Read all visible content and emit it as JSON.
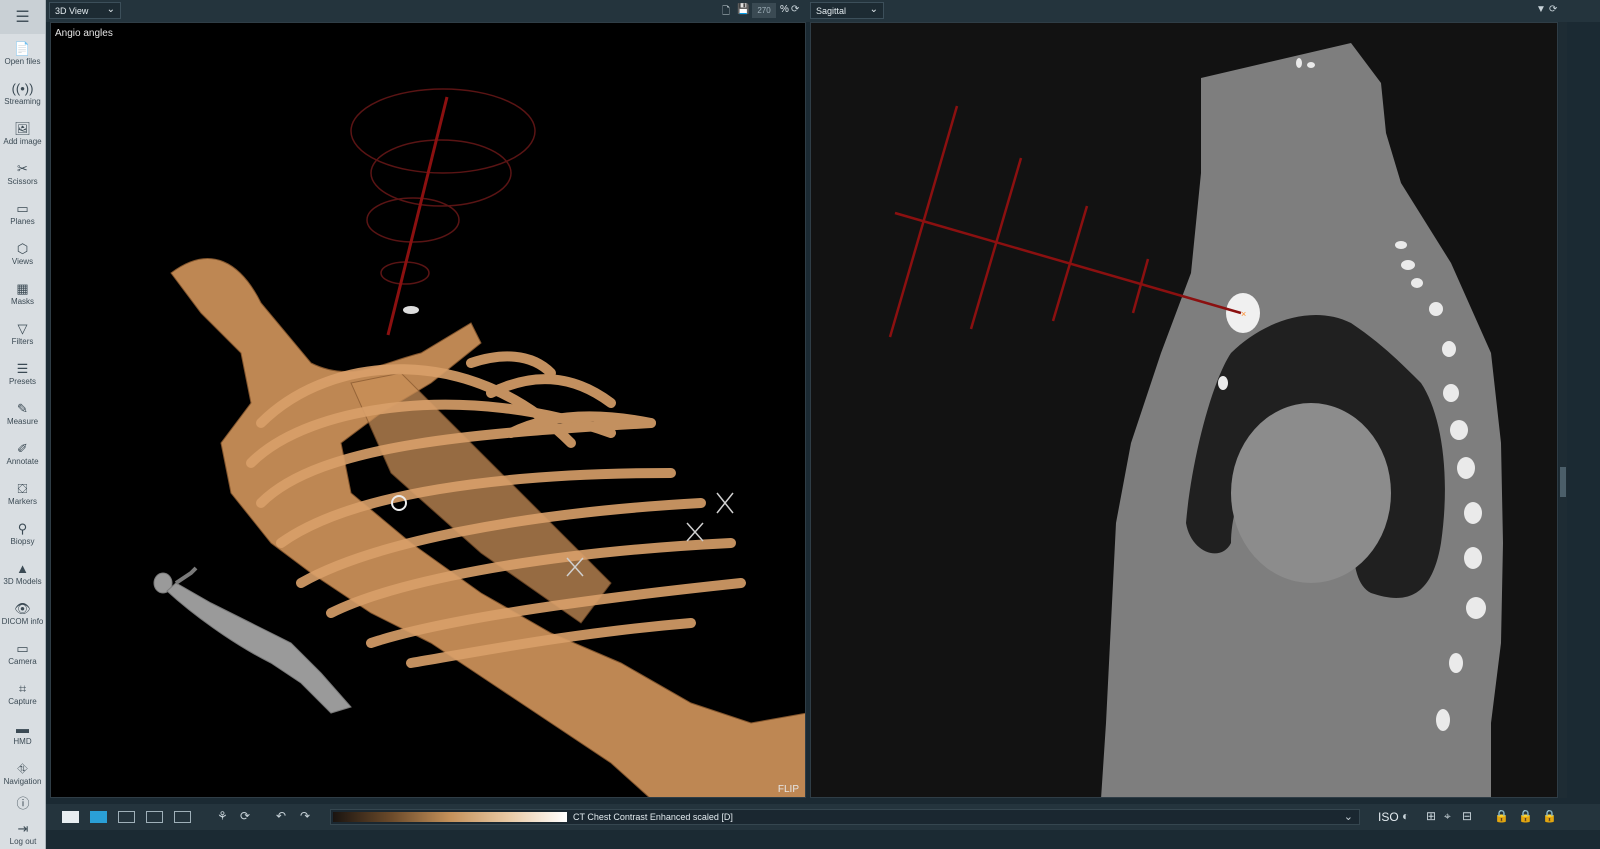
{
  "sidebar": {
    "menu_icon": "hamburger-icon",
    "items": [
      {
        "label": "Open files",
        "icon": "📄"
      },
      {
        "label": "Streaming",
        "icon": "((•))"
      },
      {
        "label": "Add image",
        "icon": "🖼"
      },
      {
        "label": "Scissors",
        "icon": "✂"
      },
      {
        "label": "Planes",
        "icon": "▭"
      },
      {
        "label": "Views",
        "icon": "⬡"
      },
      {
        "label": "Masks",
        "icon": "▦"
      },
      {
        "label": "Filters",
        "icon": "▽"
      },
      {
        "label": "Presets",
        "icon": "☰"
      },
      {
        "label": "Measure",
        "icon": "✎"
      },
      {
        "label": "Annotate",
        "icon": "✐"
      },
      {
        "label": "Markers",
        "icon": "⛋"
      },
      {
        "label": "Biopsy",
        "icon": "⚲"
      },
      {
        "label": "3D Models",
        "icon": "▲"
      },
      {
        "label": "DICOM info",
        "icon": "👁"
      },
      {
        "label": "Camera",
        "icon": "▭"
      },
      {
        "label": "Capture",
        "icon": "⌗"
      },
      {
        "label": "HMD",
        "icon": "▬"
      },
      {
        "label": "Navigation",
        "icon": "⛗"
      }
    ],
    "bottom": [
      {
        "label": "",
        "icon": "ⓘ"
      },
      {
        "label": "Log out",
        "icon": "⇥"
      }
    ]
  },
  "left_view": {
    "select_label": "3D View",
    "zoom_value": "270",
    "zoom_unit": "%",
    "overlay_title": "Angio angles",
    "flip_label": "FLIP"
  },
  "right_view": {
    "select_label": "Sagittal"
  },
  "bottombar": {
    "colormap_name": "CT Chest Contrast Enhanced scaled [D]",
    "iso_label": "ISO"
  },
  "colors": {
    "accent": "#2a9fd6",
    "bone": "#d9a06a",
    "angle_line": "#8b1010"
  }
}
